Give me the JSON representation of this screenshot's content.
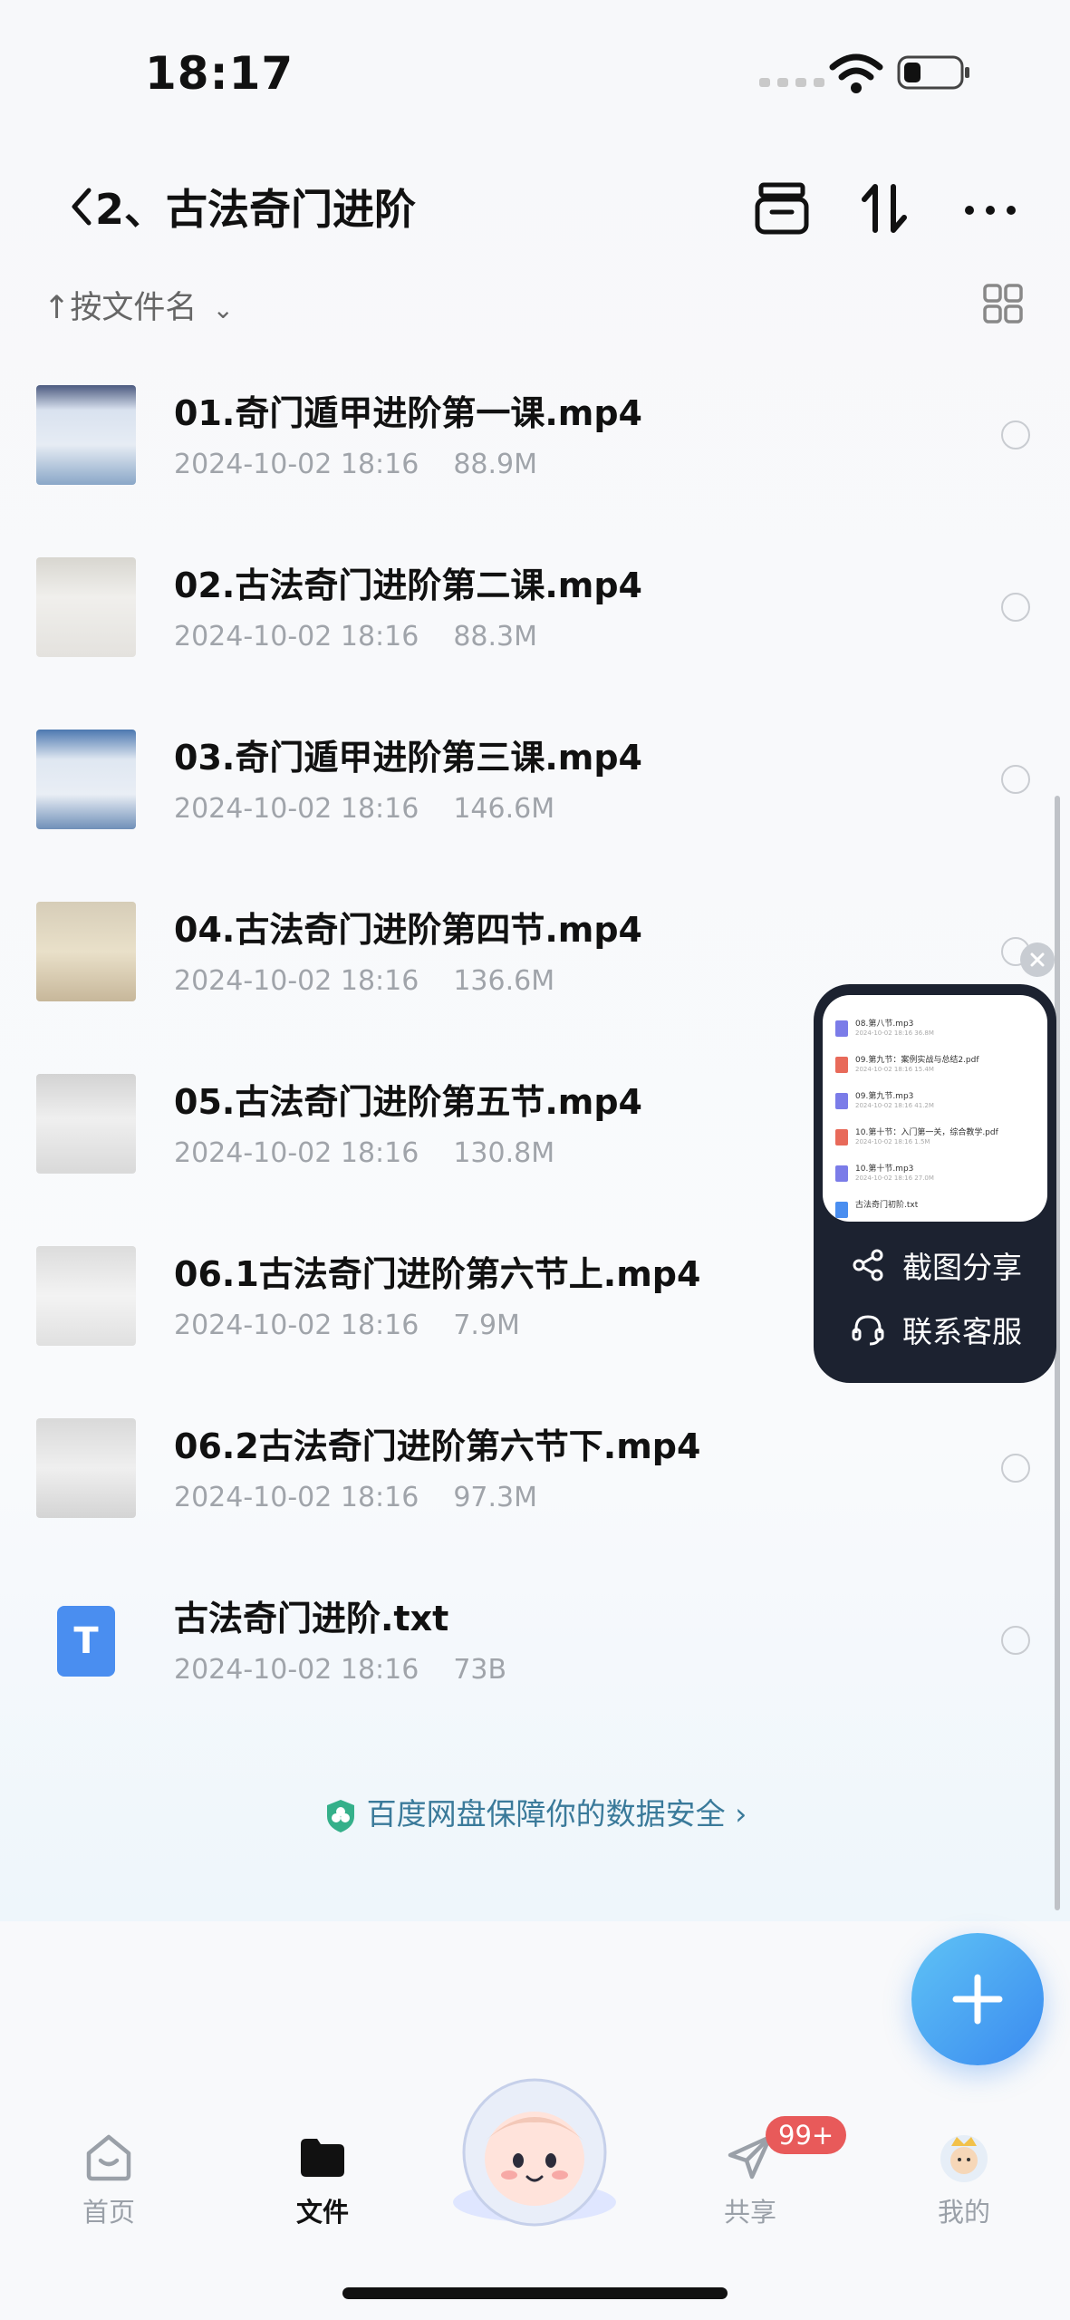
{
  "status_bar": {
    "time": "18:17"
  },
  "header": {
    "title": "2、古法奇门进阶"
  },
  "sort": {
    "label": "按文件名"
  },
  "files": [
    {
      "name": "01.奇门遁甲进阶第一课.mp4",
      "date": "2024-10-02 18:16",
      "size": "88.9M",
      "thumb": "video"
    },
    {
      "name": "02.古法奇门进阶第二课.mp4",
      "date": "2024-10-02 18:16",
      "size": "88.3M",
      "thumb": "video"
    },
    {
      "name": "03.奇门遁甲进阶第三课.mp4",
      "date": "2024-10-02 18:16",
      "size": "146.6M",
      "thumb": "video"
    },
    {
      "name": "04.古法奇门进阶第四节.mp4",
      "date": "2024-10-02 18:16",
      "size": "136.6M",
      "thumb": "video"
    },
    {
      "name": "05.古法奇门进阶第五节.mp4",
      "date": "2024-10-02 18:16",
      "size": "130.8M",
      "thumb": "video"
    },
    {
      "name": "06.1古法奇门进阶第六节上.mp4",
      "date": "2024-10-02 18:16",
      "size": "7.9M",
      "thumb": "video"
    },
    {
      "name": "06.2古法奇门进阶第六节下.mp4",
      "date": "2024-10-02 18:16",
      "size": "97.3M",
      "thumb": "video"
    },
    {
      "name": "古法奇门进阶.txt",
      "date": "2024-10-02 18:16",
      "size": "73B",
      "thumb": "txt",
      "icon_letter": "T"
    }
  ],
  "safety_link": {
    "text": "百度网盘保障你的数据安全 ›"
  },
  "popup": {
    "preview_rows": [
      {
        "name": "08.第八节.mp3",
        "meta": "2024-10-02 18:16 36.8M",
        "color": "#7b7ce8"
      },
      {
        "name": "09.第九节：案例实战与总结2.pdf",
        "meta": "2024-10-02 18:16 15.4M",
        "color": "#e86a5a"
      },
      {
        "name": "09.第九节.mp3",
        "meta": "2024-10-02 18:16 41.2M",
        "color": "#7b7ce8"
      },
      {
        "name": "10.第十节：入门第一关，综合教学.pdf",
        "meta": "2024-10-02 18:16 1.5M",
        "color": "#e86a5a"
      },
      {
        "name": "10.第十节.mp3",
        "meta": "2024-10-02 18:16 27.0M",
        "color": "#7b7ce8"
      },
      {
        "name": "古法奇门初阶.txt",
        "meta": "",
        "color": "#4a8ef0"
      }
    ],
    "share_label": "截图分享",
    "service_label": "联系客服"
  },
  "tabbar": {
    "tabs": [
      {
        "label": "首页",
        "icon": "home-icon",
        "active": false
      },
      {
        "label": "文件",
        "icon": "folder-icon",
        "active": true
      },
      {
        "label": "共享",
        "icon": "send-icon",
        "active": false
      },
      {
        "label": "我的",
        "icon": "avatar-icon",
        "active": false
      }
    ],
    "share_badge": "99+"
  },
  "colors": {
    "accent": "#3a8af0",
    "badge": "#e85a5a",
    "popup_bg": "#1c2230"
  }
}
